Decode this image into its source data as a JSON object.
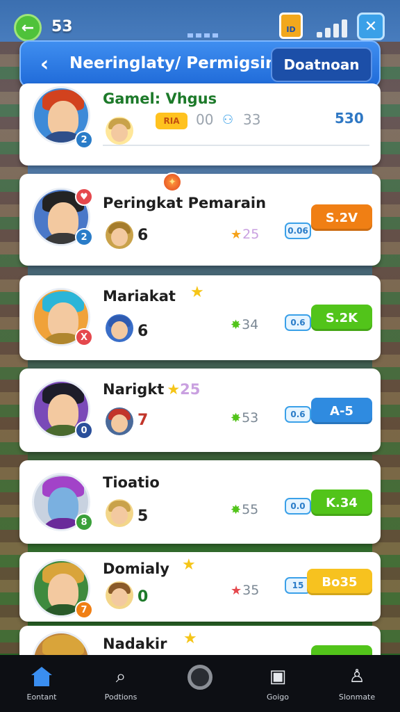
{
  "status": {
    "count": "53",
    "chest_label": "ID"
  },
  "header": {
    "back_icon": "chevron-left-icon",
    "title": "Neeringlaty/ Permigsin",
    "action_label": "Doatnoan"
  },
  "top_card": {
    "title": "Gamel: Vhgus",
    "pill": "RIA",
    "stat1": "00",
    "stat2": "33",
    "score": "530",
    "rank": "2"
  },
  "players": [
    {
      "name": "Peringkat Pemarain",
      "rank": "2",
      "level": "6",
      "star_stat": "25",
      "chip": "0.06",
      "score": "S.2V",
      "score_color": "#f07f14",
      "rank_color": "#2a7cc8"
    },
    {
      "name": "Mariakat",
      "rank": "X",
      "level": "6",
      "star_stat": "34",
      "chip": "0.6",
      "score": "S.2K",
      "score_color": "#52c41a",
      "rank_color": "#e5484d"
    },
    {
      "name": "Narigkt",
      "name_suffix": "25",
      "rank": "0",
      "level": "7",
      "star_stat": "53",
      "chip": "0.6",
      "score": "A-5",
      "score_color": "#2f8be0",
      "rank_color": "#2a4f9a"
    },
    {
      "name": "Tioatio",
      "rank": "8",
      "level": "5",
      "star_stat": "55",
      "chip": "0.0",
      "score": "K.34",
      "score_color": "#52c41a",
      "rank_color": "#3aa03a"
    },
    {
      "name": "Domialy",
      "rank": "7",
      "level": "0",
      "star_stat": "35",
      "chip": "15",
      "score": "Bo35",
      "score_color": "#f7c21f",
      "rank_color": "#f07f14"
    },
    {
      "name": "Nadakir"
    }
  ],
  "bottom_nav": [
    {
      "label": "Eontant",
      "icon": "home-icon"
    },
    {
      "label": "Podtions",
      "icon": "search-icon"
    },
    {
      "label": "",
      "icon": "record-icon"
    },
    {
      "label": "Goigo",
      "icon": "chart-icon"
    },
    {
      "label": "Slonmate",
      "icon": "profile-icon"
    }
  ]
}
